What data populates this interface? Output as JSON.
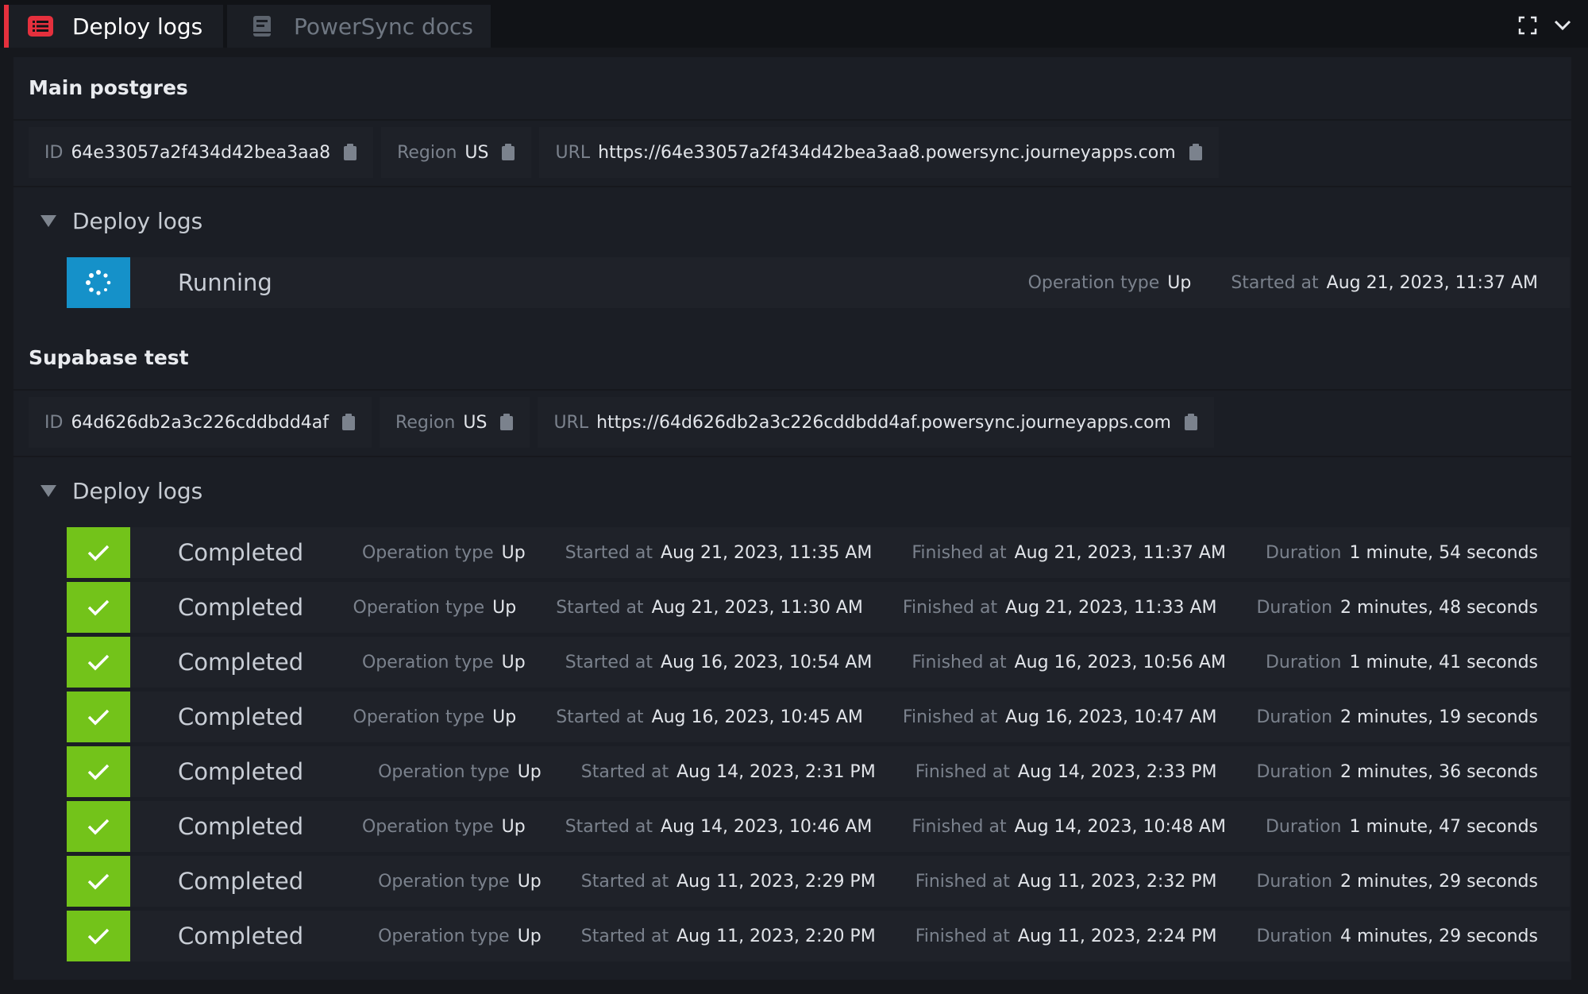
{
  "tabs": [
    {
      "label": "Deploy logs",
      "icon": "list-icon",
      "active": true
    },
    {
      "label": "PowerSync docs",
      "icon": "book-icon",
      "active": false
    }
  ],
  "toolbar": {
    "fullscreen_icon": "fullscreen-icon",
    "menu_icon": "chevron-down-icon"
  },
  "colors": {
    "accent": "#e5303d",
    "success": "#73c31a",
    "running": "#1591c9"
  },
  "instances": [
    {
      "name": "Main postgres",
      "id_label": "ID",
      "id": "64e33057a2f434d42bea3aa8",
      "region_label": "Region",
      "region": "US",
      "url_label": "URL",
      "url": "https://64e33057a2f434d42bea3aa8.powersync.journeyapps.com",
      "logs_title": "Deploy logs",
      "logs": [
        {
          "status": "Running",
          "op_label": "Operation type",
          "op": "Up",
          "started_label": "Started at",
          "started": "Aug 21, 2023, 11:37 AM"
        }
      ]
    },
    {
      "name": "Supabase test",
      "id_label": "ID",
      "id": "64d626db2a3c226cddbdd4af",
      "region_label": "Region",
      "region": "US",
      "url_label": "URL",
      "url": "https://64d626db2a3c226cddbdd4af.powersync.journeyapps.com",
      "logs_title": "Deploy logs",
      "logs": [
        {
          "status": "Completed",
          "op_label": "Operation type",
          "op": "Up",
          "started_label": "Started at",
          "started": "Aug 21, 2023, 11:35 AM",
          "finished_label": "Finished at",
          "finished": "Aug 21, 2023, 11:37 AM",
          "duration_label": "Duration",
          "duration": "1 minute, 54 seconds"
        },
        {
          "status": "Completed",
          "op_label": "Operation type",
          "op": "Up",
          "started_label": "Started at",
          "started": "Aug 21, 2023, 11:30 AM",
          "finished_label": "Finished at",
          "finished": "Aug 21, 2023, 11:33 AM",
          "duration_label": "Duration",
          "duration": "2 minutes, 48 seconds"
        },
        {
          "status": "Completed",
          "op_label": "Operation type",
          "op": "Up",
          "started_label": "Started at",
          "started": "Aug 16, 2023, 10:54 AM",
          "finished_label": "Finished at",
          "finished": "Aug 16, 2023, 10:56 AM",
          "duration_label": "Duration",
          "duration": "1 minute, 41 seconds"
        },
        {
          "status": "Completed",
          "op_label": "Operation type",
          "op": "Up",
          "started_label": "Started at",
          "started": "Aug 16, 2023, 10:45 AM",
          "finished_label": "Finished at",
          "finished": "Aug 16, 2023, 10:47 AM",
          "duration_label": "Duration",
          "duration": "2 minutes, 19 seconds"
        },
        {
          "status": "Completed",
          "op_label": "Operation type",
          "op": "Up",
          "started_label": "Started at",
          "started": "Aug 14, 2023, 2:31 PM",
          "finished_label": "Finished at",
          "finished": "Aug 14, 2023, 2:33 PM",
          "duration_label": "Duration",
          "duration": "2 minutes, 36 seconds"
        },
        {
          "status": "Completed",
          "op_label": "Operation type",
          "op": "Up",
          "started_label": "Started at",
          "started": "Aug 14, 2023, 10:46 AM",
          "finished_label": "Finished at",
          "finished": "Aug 14, 2023, 10:48 AM",
          "duration_label": "Duration",
          "duration": "1 minute, 47 seconds"
        },
        {
          "status": "Completed",
          "op_label": "Operation type",
          "op": "Up",
          "started_label": "Started at",
          "started": "Aug 11, 2023, 2:29 PM",
          "finished_label": "Finished at",
          "finished": "Aug 11, 2023, 2:32 PM",
          "duration_label": "Duration",
          "duration": "2 minutes, 29 seconds"
        },
        {
          "status": "Completed",
          "op_label": "Operation type",
          "op": "Up",
          "started_label": "Started at",
          "started": "Aug 11, 2023, 2:20 PM",
          "finished_label": "Finished at",
          "finished": "Aug 11, 2023, 2:24 PM",
          "duration_label": "Duration",
          "duration": "4 minutes, 29 seconds"
        }
      ]
    }
  ]
}
